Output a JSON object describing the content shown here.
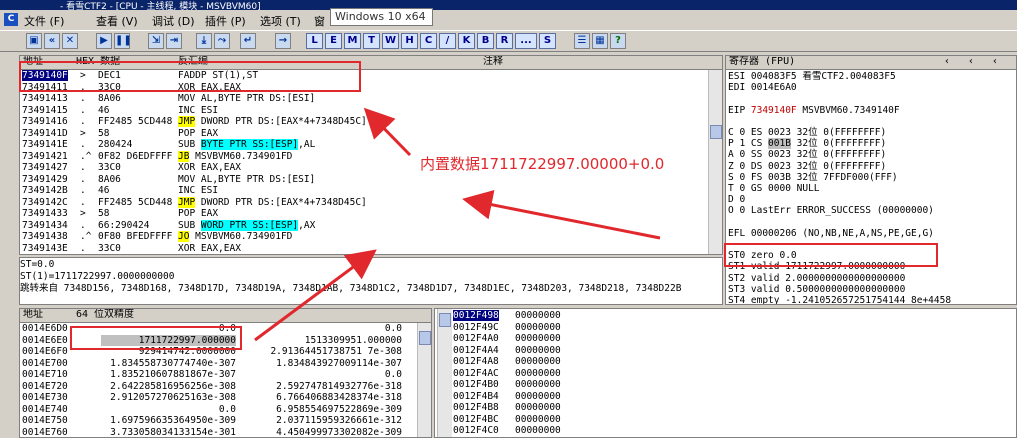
{
  "window": {
    "title": "- 看雪CTF2 - [CPU - 主线程, 模块 - MSVBVM60]"
  },
  "menu": {
    "app_icon": "C",
    "items": [
      "文件 (F)",
      "查看 (V)",
      "调试 (D)",
      "插件 (P)",
      "选项 (T)",
      "窗"
    ]
  },
  "tooltip": "Windows 10 x64",
  "toolbar": {
    "letters": [
      "L",
      "E",
      "M",
      "T",
      "W",
      "H",
      "C",
      "/",
      "K",
      "B",
      "R",
      "...",
      "S"
    ]
  },
  "disasm": {
    "headers": {
      "address": "地址",
      "hex": "HEX 数据",
      "disasm": "反汇编",
      "comment": "注释"
    },
    "rows": [
      {
        "addr": "7349140F",
        "mark": ">",
        "hex": "DEC1",
        "asm": "FADDP ST(1),ST",
        "selected": true
      },
      {
        "addr": "73491411",
        "mark": ".",
        "hex": "33C0",
        "asm": "XOR EAX,EAX"
      },
      {
        "addr": "73491413",
        "mark": ".",
        "hex": "8A06",
        "asm": "MOV AL,BYTE PTR DS:[ESI]"
      },
      {
        "addr": "73491415",
        "mark": ".",
        "hex": "46",
        "asm": "INC ESI"
      },
      {
        "addr": "73491416",
        "mark": ".",
        "hex": "FF2485 5CD448",
        "asm_op": "JMP",
        "asm_rest": " DWORD PTR DS:[EAX*4+7348D45C]",
        "kind": "jmp"
      },
      {
        "addr": "7349141D",
        "mark": ">",
        "hex": "58",
        "asm": "POP EAX"
      },
      {
        "addr": "7349141E",
        "mark": ".",
        "hex": "280424",
        "asm_op": "SUB",
        "asm_hl": "BYTE PTR SS:[ESP]",
        "asm_rest": ",AL",
        "kind": "hl"
      },
      {
        "addr": "73491421",
        "mark": ".^",
        "hex": "0F82 D6EDFFFF",
        "asm_op": "JB",
        "asm_rest": " MSVBVM60.734901FD",
        "kind": "jmp"
      },
      {
        "addr": "73491427",
        "mark": ".",
        "hex": "33C0",
        "asm": "XOR EAX,EAX"
      },
      {
        "addr": "73491429",
        "mark": ".",
        "hex": "8A06",
        "asm": "MOV AL,BYTE PTR DS:[ESI]"
      },
      {
        "addr": "7349142B",
        "mark": ".",
        "hex": "46",
        "asm": "INC ESI"
      },
      {
        "addr": "7349142C",
        "mark": ".",
        "hex": "FF2485 5CD448",
        "asm_op": "JMP",
        "asm_rest": " DWORD PTR DS:[EAX*4+7348D45C]",
        "kind": "jmp"
      },
      {
        "addr": "73491433",
        "mark": ">",
        "hex": "58",
        "asm": "POP EAX"
      },
      {
        "addr": "73491434",
        "mark": ".",
        "hex": "66:290424",
        "asm_op": "SUB",
        "asm_hl": "WORD PTR SS:[ESP]",
        "asm_rest": ",AX",
        "kind": "hl"
      },
      {
        "addr": "73491438",
        "mark": ".^",
        "hex": "0F80 BFEDFFFF",
        "asm_op": "JO",
        "asm_rest": " MSVBVM60.734901FD",
        "kind": "jmp"
      },
      {
        "addr": "7349143E",
        "mark": ".",
        "hex": "33C0",
        "asm": "XOR EAX,EAX"
      }
    ]
  },
  "info": {
    "lines": [
      "ST=0.0",
      "ST(1)=1711722997.0000000000",
      "跳转来自 7348D156, 7348D168, 7348D17D, 7348D19A, 7348D1AB, 7348D1C2, 7348D1D7, 7348D1EC, 7348D203, 7348D218, 7348D22B"
    ]
  },
  "registers": {
    "title": "寄存器 (FPU)",
    "lines": [
      {
        "text": "ESI 004083F5 看雪CTF2.004083F5"
      },
      {
        "text": "EDI 0014E6A0"
      },
      {
        "text": ""
      },
      {
        "pre": "EIP ",
        "red": "7349140F",
        "post": " MSVBVM60.7349140F"
      },
      {
        "text": ""
      },
      {
        "text": "C 0   ES 0023 32位 0(FFFFFFFF)"
      },
      {
        "pre": "P 1   CS ",
        "boxed": "001B",
        "post": " 32位 0(FFFFFFFF)"
      },
      {
        "text": "A 0   SS 0023 32位 0(FFFFFFFF)"
      },
      {
        "text": "Z 0   DS 0023 32位 0(FFFFFFFF)"
      },
      {
        "text": "S 0   FS 003B 32位 7FFDF000(FFF)"
      },
      {
        "text": "T 0   GS 0000 NULL"
      },
      {
        "text": "D 0"
      },
      {
        "text": "O 0   LastErr ERROR_SUCCESS (00000000)"
      },
      {
        "text": ""
      },
      {
        "text": "EFL 00000206 (NO,NB,NE,A,NS,PE,GE,G)"
      },
      {
        "text": ""
      },
      {
        "text": "ST0 zero  0.0"
      },
      {
        "text": "ST1 valid 1711722997.0000000000"
      },
      {
        "text": "ST2 valid 2.0000000000000000000"
      },
      {
        "text": "ST3 valid 0.5000000000000000000"
      },
      {
        "text": "ST4 empty -1.241052657251754144 8e+4458"
      },
      {
        "text": "ST5 empty -UNORM E460 0012FF3C BF800BBB"
      }
    ]
  },
  "dump": {
    "headers": {
      "address": "地址",
      "format": "64 位双精度"
    },
    "rows": [
      {
        "addr": "0014E6D0",
        "v1": "0.0",
        "v2": "0.0"
      },
      {
        "addr": "0014E6E0",
        "v1": "1711722997.000000",
        "v2": "1513309951.000000",
        "selected": true
      },
      {
        "addr": "0014E6F0",
        "v1": "929414742.0000000",
        "v2": "2.91364451738751 7e-308"
      },
      {
        "addr": "0014E700",
        "v1": "1.834558730774740e-307",
        "v2": "1.834843927009114e-307"
      },
      {
        "addr": "0014E710",
        "v1": "1.835210607881867e-307",
        "v2": "0.0"
      },
      {
        "addr": "0014E720",
        "v1": "2.642285816956256e-308",
        "v2": "2.592747814932776e-318"
      },
      {
        "addr": "0014E730",
        "v1": "2.912057270625163e-308",
        "v2": "6.766406883428374e-318"
      },
      {
        "addr": "0014E740",
        "v1": "0.0",
        "v2": "6.958554697522869e-309"
      },
      {
        "addr": "0014E750",
        "v1": "1.697596635364950e-309",
        "v2": "2.037115959326661e-312"
      },
      {
        "addr": "0014E760",
        "v1": "3.733058034133154e-301",
        "v2": "4.450499973302082e-309"
      }
    ]
  },
  "stack": {
    "rows": [
      {
        "addr": "0012F498",
        "val": "00000000",
        "selected": true
      },
      {
        "addr": "0012F49C",
        "val": "00000000"
      },
      {
        "addr": "0012F4A0",
        "val": "00000000"
      },
      {
        "addr": "0012F4A4",
        "val": "00000000"
      },
      {
        "addr": "0012F4A8",
        "val": "00000000"
      },
      {
        "addr": "0012F4AC",
        "val": "00000000"
      },
      {
        "addr": "0012F4B0",
        "val": "00000000"
      },
      {
        "addr": "0012F4B4",
        "val": "00000000"
      },
      {
        "addr": "0012F4B8",
        "val": "00000000"
      },
      {
        "addr": "0012F4BC",
        "val": "00000000"
      },
      {
        "addr": "0012F4C0",
        "val": "00000000"
      }
    ]
  },
  "annotation": {
    "text": "内置数据1711722997.00000+0.0",
    "color": "#e0282d"
  }
}
